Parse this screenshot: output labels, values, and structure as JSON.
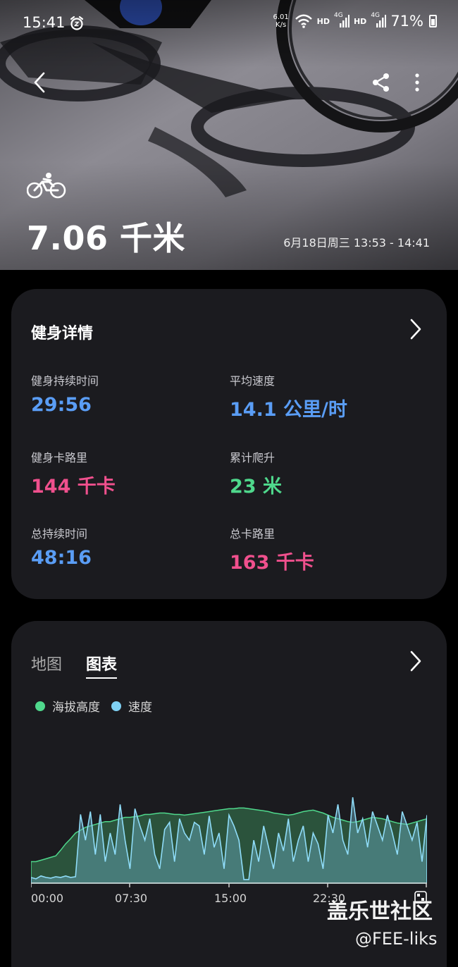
{
  "status_bar": {
    "time": "15:41",
    "net_speed_value": "6.01",
    "net_speed_unit": "K/s",
    "hd1": "HD",
    "net1": "4G",
    "hd2": "HD",
    "net2": "4G",
    "battery": "71%"
  },
  "hero": {
    "distance": "7.06 千米",
    "datetime": "6月18日周三 13:53 - 14:41"
  },
  "details": {
    "title": "健身详情",
    "metrics": [
      {
        "label": "健身持续时间",
        "value": "29:56",
        "color": "#5a9df5"
      },
      {
        "label": "平均速度",
        "value": "14.1 公里/时",
        "color": "#5a9df5"
      },
      {
        "label": "健身卡路里",
        "value": "144 千卡",
        "color": "#f0508d"
      },
      {
        "label": "累计爬升",
        "value": "23 米",
        "color": "#4fd88c"
      },
      {
        "label": "总持续时间",
        "value": "48:16",
        "color": "#5a9df5"
      },
      {
        "label": "总卡路里",
        "value": "163 千卡",
        "color": "#f0508d"
      }
    ]
  },
  "chart_card": {
    "tabs": [
      "地图",
      "图表"
    ],
    "active_tab": "图表",
    "legend": [
      {
        "name": "海拔高度",
        "color": "#4fd88c"
      },
      {
        "name": "速度",
        "color": "#7fd1f4"
      }
    ]
  },
  "chart_data": {
    "type": "area",
    "x_ticks": [
      "00:00",
      "07:30",
      "15:00",
      "22:30"
    ],
    "series": [
      {
        "name": "海拔高度",
        "values": [
          30,
          30,
          32,
          34,
          36,
          38,
          46,
          55,
          62,
          70,
          74,
          78,
          80,
          82,
          84,
          86,
          86,
          88,
          90,
          92,
          92,
          93,
          94,
          96,
          96,
          97,
          98,
          98,
          97,
          96,
          96,
          95,
          96,
          97,
          98,
          99,
          100,
          101,
          102,
          103,
          104,
          104,
          105,
          105,
          104,
          103,
          102,
          101,
          100,
          98,
          97,
          96,
          95,
          96,
          98,
          100,
          101,
          102,
          100,
          98,
          95,
          92,
          90,
          88,
          86,
          85,
          86,
          88,
          90,
          92,
          91,
          90,
          88,
          86,
          84,
          83,
          82,
          84,
          86,
          88,
          90
        ]
      },
      {
        "name": "速度",
        "values": [
          8,
          6,
          10,
          8,
          7,
          9,
          8,
          10,
          8,
          9,
          96,
          60,
          100,
          40,
          96,
          30,
          70,
          40,
          110,
          60,
          20,
          104,
          80,
          60,
          90,
          40,
          20,
          75,
          85,
          30,
          90,
          70,
          60,
          85,
          80,
          40,
          94,
          50,
          70,
          20,
          95,
          80,
          60,
          5,
          5,
          60,
          30,
          80,
          50,
          20,
          70,
          45,
          90,
          30,
          60,
          80,
          30,
          70,
          55,
          20,
          95,
          70,
          110,
          60,
          40,
          120,
          70,
          90,
          50,
          100,
          80,
          60,
          95,
          70,
          40,
          100,
          80,
          60,
          85,
          30,
          95
        ]
      }
    ]
  },
  "watermark": {
    "text": "盖乐世社区",
    "handle": "@FEE-liks"
  }
}
